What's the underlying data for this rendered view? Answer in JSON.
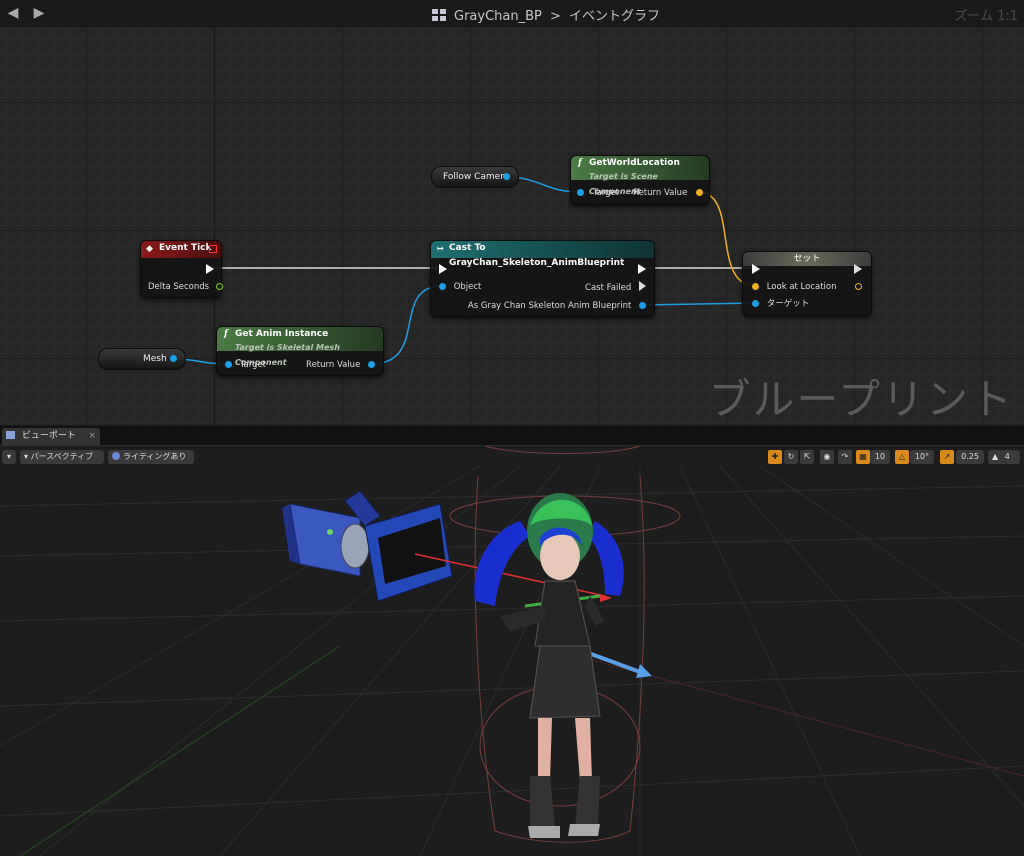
{
  "graph": {
    "breadcrumb_blueprint": "GrayChan_BP",
    "breadcrumb_separator": ">",
    "breadcrumb_graph": "イベントグラフ",
    "zoom_label": "ズーム 1:1",
    "watermark": "ブループリント"
  },
  "nodes": {
    "event_tick": {
      "title": "Event Tick",
      "out_param": "Delta Seconds"
    },
    "get_world_location": {
      "title": "GetWorldLocation",
      "subtitle": "Target is Scene Component",
      "in_param": "Target",
      "out_param": "Return Value"
    },
    "follow_camera": {
      "label": "Follow Camera"
    },
    "cast": {
      "title": "Cast To GrayChan_Skeleton_AnimBlueprint",
      "in_param": "Object",
      "out_fail": "Cast Failed",
      "out_param": "As Gray Chan Skeleton Anim Blueprint"
    },
    "set": {
      "title": "セット",
      "in_value": "Look at Location",
      "in_target": "ターゲット"
    },
    "get_anim_instance": {
      "title": "Get Anim Instance",
      "subtitle": "Target is Skeletal Mesh Component",
      "in_param": "Target",
      "out_param": "Return Value"
    },
    "mesh": {
      "label": "Mesh"
    }
  },
  "viewport": {
    "tab_label": "ビューポート",
    "perspective_label": "パースペクティブ",
    "lighting_label": "ライティングあり",
    "grid_snap": "10",
    "rotation_snap": "10°",
    "scale_snap": "0.25",
    "camera_speed": "4"
  },
  "colors": {
    "event_header": "#8c1a1a",
    "function_header": "#3f6b3a",
    "cast_header": "#1d5e60",
    "set_header": "#6b6b6b",
    "object_pin": "#1aa0e8",
    "vector_pin": "#f2b01e",
    "bool_pin": "#7fd11a",
    "exec_wire": "#d8d8d8",
    "accent": "#d98a1c"
  }
}
